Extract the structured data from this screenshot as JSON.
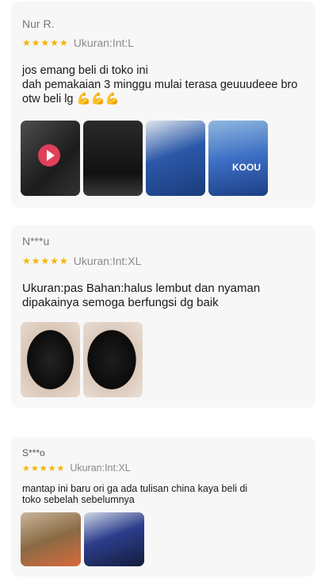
{
  "reviews": [
    {
      "name": "Nur R.",
      "stars": "★★★★★",
      "rating": 5,
      "size": "Ukuran:Int:L",
      "text_lines": [
        "jos emang beli di toko ini",
        "dah pemakaian 3 minggu mulai terasa geuuudeee bro",
        "otw beli lg 💪💪💪"
      ],
      "thumbnails": [
        "video-thumbnail",
        "product-photo",
        "product-photo",
        "product-photo"
      ],
      "thumb_text": [
        "",
        "",
        "",
        "KOOU"
      ]
    },
    {
      "name": "N***u",
      "stars": "★★★★★",
      "rating": 5,
      "size": "Ukuran:Int:XL",
      "text_lines": [
        "Ukuran:pas Bahan:halus lembut dan nyaman",
        "dipakainya semoga berfungsi dg baik"
      ],
      "thumbnails": [
        "product-photo",
        "product-photo"
      ]
    },
    {
      "name": "S***o",
      "stars": "★★★★★",
      "rating": 5,
      "size": "Ukuran:Int:XL",
      "text_lines": [
        "mantap ini baru ori ga ada tulisan china kaya beli di",
        "toko sebelah sebelumnya"
      ],
      "thumbnails": [
        "product-photo",
        "product-photo"
      ]
    }
  ],
  "colors": {
    "star": "#f4b400",
    "card_bg": "#f7f7f7",
    "play_button": "#e0405a"
  }
}
